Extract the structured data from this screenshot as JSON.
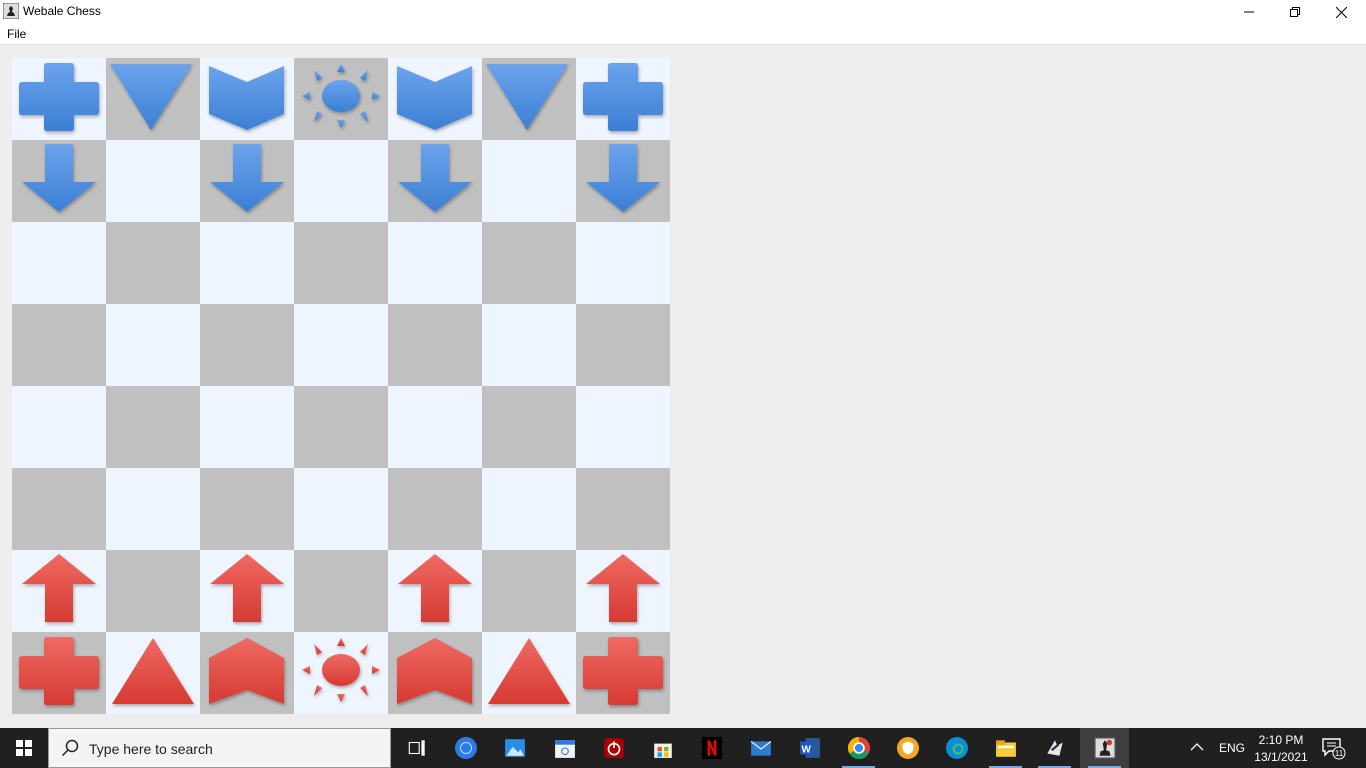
{
  "window": {
    "title": "Webale Chess",
    "menu": [
      "File"
    ]
  },
  "board": {
    "rows": 8,
    "cols": 7,
    "squares": [
      [
        "light",
        "dark",
        "light",
        "dark",
        "light",
        "dark",
        "light"
      ],
      [
        "dark",
        "light",
        "dark",
        "light",
        "dark",
        "light",
        "dark"
      ],
      [
        "light",
        "dark",
        "light",
        "dark",
        "light",
        "dark",
        "light"
      ],
      [
        "dark",
        "light",
        "dark",
        "light",
        "dark",
        "light",
        "dark"
      ],
      [
        "light",
        "dark",
        "light",
        "dark",
        "light",
        "dark",
        "light"
      ],
      [
        "dark",
        "light",
        "dark",
        "light",
        "dark",
        "light",
        "dark"
      ],
      [
        "light",
        "dark",
        "light",
        "dark",
        "light",
        "dark",
        "light"
      ],
      [
        "dark",
        "light",
        "dark",
        "light",
        "dark",
        "light",
        "dark"
      ]
    ],
    "pieces": [
      [
        "blue-cross",
        "blue-triangle",
        "blue-chevron",
        "blue-sun",
        "blue-chevron",
        "blue-triangle",
        "blue-cross"
      ],
      [
        "blue-arrow",
        "",
        "blue-arrow",
        "",
        "blue-arrow",
        "",
        "blue-arrow"
      ],
      [
        "",
        "",
        "",
        "",
        "",
        "",
        ""
      ],
      [
        "",
        "",
        "",
        "",
        "",
        "",
        ""
      ],
      [
        "",
        "",
        "",
        "",
        "",
        "",
        ""
      ],
      [
        "",
        "",
        "",
        "",
        "",
        "",
        ""
      ],
      [
        "red-arrow",
        "",
        "red-arrow",
        "",
        "red-arrow",
        "",
        "red-arrow"
      ],
      [
        "red-cross",
        "red-triangle",
        "red-chevron",
        "red-sun",
        "red-chevron",
        "red-triangle",
        "red-cross"
      ]
    ],
    "colors": {
      "light_square": "#eff5fe",
      "dark_square": "#c0c0c0",
      "blue_piece": "#3b7fd4",
      "red_piece": "#d63a33"
    }
  },
  "taskbar": {
    "search_placeholder": "Type here to search",
    "apps": [
      "task-view-icon",
      "app-globe-icon",
      "photos-icon",
      "calendar-icon",
      "power-app-icon",
      "store-icon",
      "netflix-icon",
      "mail-icon",
      "word-icon",
      "chrome-icon",
      "vpn-shield-icon",
      "edge-icon",
      "file-explorer-icon",
      "eclipse-icon",
      "webale-chess-icon"
    ],
    "tray": {
      "language": "ENG",
      "time": "2:10 PM",
      "date": "13/1/2021",
      "notifications": "11"
    }
  }
}
